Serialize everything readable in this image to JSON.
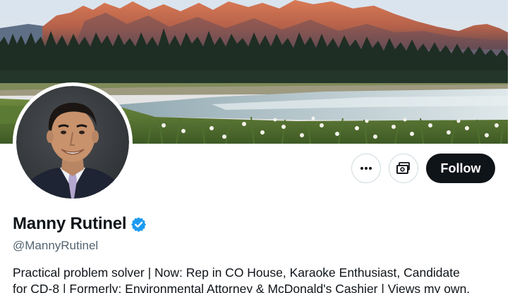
{
  "profile": {
    "display_name": "Manny Rutinel",
    "handle": "@MannyRutinel",
    "verified": true,
    "bio_lines": [
      "Practical problem solver | Now: Rep in CO House, Karaoke Enthusiast, Candidate",
      "for CD-8 | Formerly: Environmental Attorney & McDonald's Cashier | Views my own."
    ]
  },
  "actions": {
    "more_icon": "more-horizontal-icon",
    "tip_icon": "money-tip-icon",
    "follow_label": "Follow"
  },
  "colors": {
    "text_primary": "#0f1419",
    "text_secondary": "#536471",
    "verified_blue": "#1d9bf0",
    "follow_bg": "#0f1419",
    "button_border": "#cfd9de"
  }
}
